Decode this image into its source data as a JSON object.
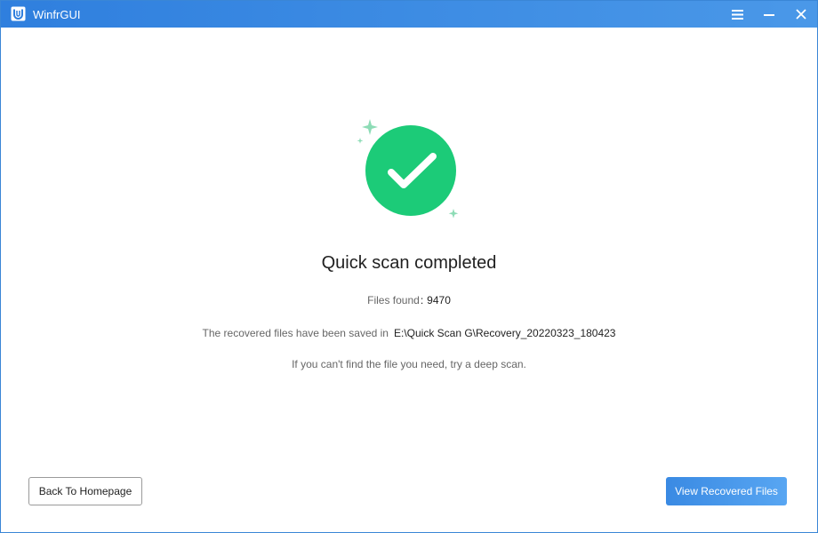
{
  "window": {
    "title": "WinfrGUI"
  },
  "titlebar": {
    "buttons": [
      "menu-icon",
      "minimize-icon",
      "close-icon"
    ]
  },
  "status": {
    "icon": "success-check-icon",
    "heading": "Quick scan completed"
  },
  "info": {
    "files_found_label": "Files found",
    "files_found_separator": ":",
    "files_found_value": "9470",
    "saved_label": "The recovered files have been saved in",
    "saved_path": "E:\\Quick Scan G\\Recovery_20220323_180423",
    "hint": "If you can't find the file you need, try a deep scan."
  },
  "actions": {
    "back_label": "Back To Homepage",
    "view_label": "View Recovered Files"
  },
  "colors": {
    "titlebar": "#3a8be4",
    "success": "#1ccb78",
    "sparkle": "#8ddcb6",
    "primary_button": "#4196ea"
  }
}
